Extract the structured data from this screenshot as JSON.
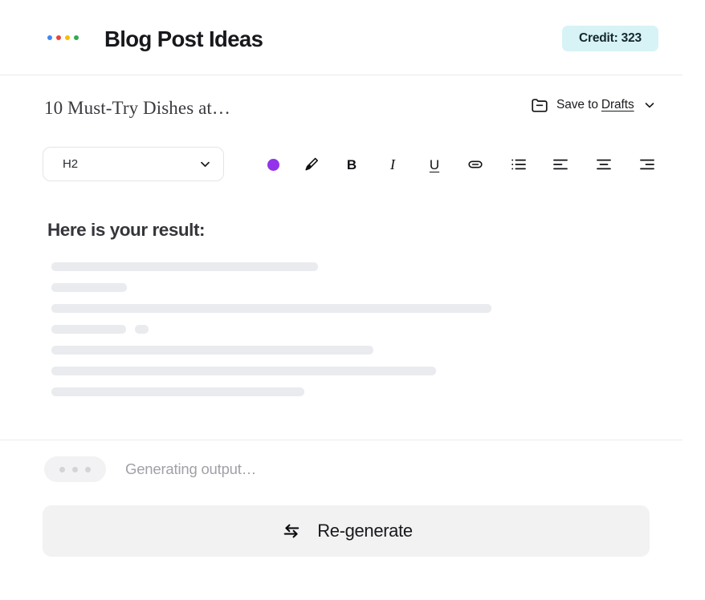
{
  "header": {
    "app_title": "Blog Post Ideas",
    "logo_icon": "four-dots-logo",
    "logo_dot_colors": [
      "#4285f4",
      "#ea4335",
      "#fbbc05",
      "#34a853"
    ],
    "credit_label": "Credit: 323",
    "credit_bg": "#d7f3f6"
  },
  "document": {
    "title": "10 Must-Try Dishes at…",
    "save": {
      "folder_icon": "folder-minus-icon",
      "prefix": "Save to",
      "destination": "Drafts",
      "chevron_icon": "chevron-down-icon"
    }
  },
  "toolbar": {
    "block_select": {
      "value": "H2",
      "chevron_icon": "chevron-down-icon"
    },
    "items": [
      {
        "name": "text-color",
        "icon": "color-swatch-icon",
        "label": "",
        "color": "#9333ea"
      },
      {
        "name": "highlight",
        "icon": "highlighter-icon",
        "label": ""
      },
      {
        "name": "bold",
        "icon": "bold-icon",
        "label": "B"
      },
      {
        "name": "italic",
        "icon": "italic-icon",
        "label": "I"
      },
      {
        "name": "underline",
        "icon": "underline-icon",
        "label": "U"
      },
      {
        "name": "link",
        "icon": "link-icon",
        "label": ""
      },
      {
        "name": "bullet-list",
        "icon": "bullet-list-icon",
        "label": ""
      },
      {
        "name": "align-left",
        "icon": "align-left-icon",
        "label": ""
      },
      {
        "name": "align-center",
        "icon": "align-center-icon",
        "label": ""
      },
      {
        "name": "align-right",
        "icon": "align-right-icon",
        "label": ""
      }
    ]
  },
  "result": {
    "heading": "Here is your result:",
    "skeleton_rows": [
      {
        "segments": [
          332
        ],
        "gap": 0
      },
      {
        "segments": [
          94
        ],
        "gap": 0
      },
      {
        "segments": [
          548
        ],
        "gap": 0
      },
      {
        "segments": [
          93,
          17
        ],
        "gap": 11
      },
      {
        "segments": [
          401
        ],
        "gap": 0
      },
      {
        "segments": [
          479
        ],
        "gap": 0
      },
      {
        "segments": [
          315
        ],
        "gap": 0
      }
    ],
    "skeleton_color": "#eaebef"
  },
  "footer": {
    "typing_indicator": {
      "icon": "typing-dots-icon",
      "dot_count": 3
    },
    "status_text": "Generating output…",
    "regenerate": {
      "icon": "swap-arrows-icon",
      "label": "Re-generate",
      "bg": "#f2f2f3"
    }
  }
}
